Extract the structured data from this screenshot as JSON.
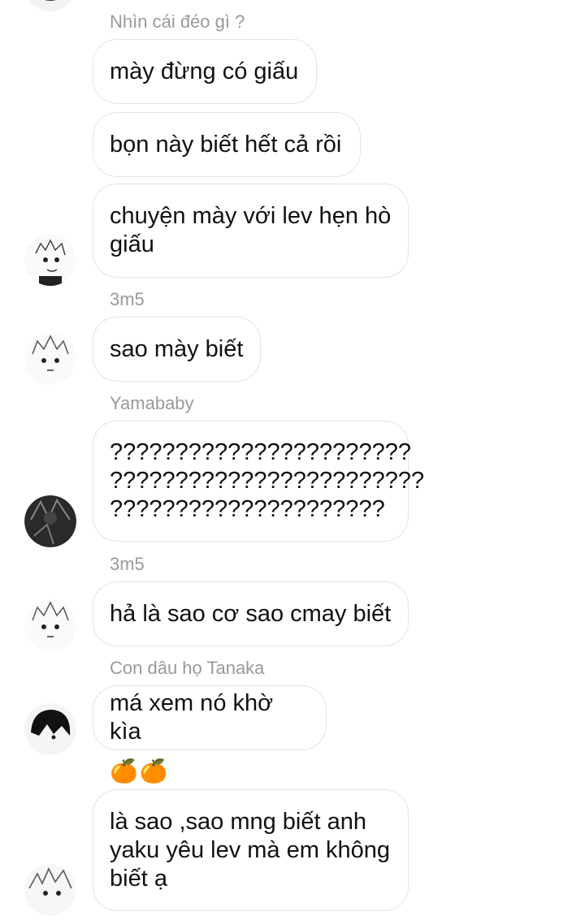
{
  "chat": {
    "names": {
      "n1": "Nhìn cái đéo gì ?",
      "n2": "3m5",
      "n3": "Yamababy",
      "n4": "3m5",
      "n5": "Con dâu họ Tanaka"
    },
    "messages": {
      "m1": "mày đừng có giấu",
      "m2": "bọn này biết hết cả rồi",
      "m3": "chuyện mày với lev hẹn hò\ngiấu",
      "m4": "sao mày biết",
      "m5": "???????????????????????\n????????????????????????\n?????????????????????",
      "m6": "hả là sao cơ sao cmay biết",
      "m7": "má xem nó khờ kìa",
      "m8": "là sao ,sao mng biết anh\nyaku yêu lev mà em không\nbiết ạ"
    },
    "emoji_name": "🍊🍊"
  }
}
